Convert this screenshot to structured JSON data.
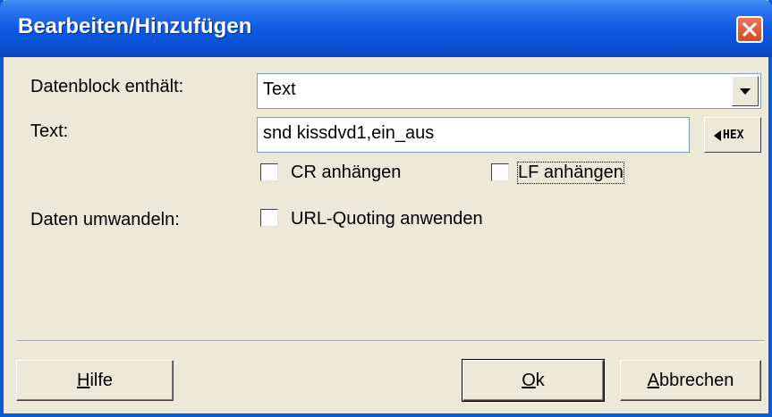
{
  "window": {
    "title": "Bearbeiten/Hinzufügen"
  },
  "labels": {
    "datenblock": "Datenblock enthält:",
    "text": "Text:",
    "daten": "Daten umwandeln:"
  },
  "datenblock_select": {
    "value": "Text"
  },
  "text_input": {
    "value": "snd kissdvd1,ein_aus"
  },
  "hex_button": {
    "label": "HEX"
  },
  "checkboxes": {
    "cr": {
      "label": "CR anhängen",
      "checked": false
    },
    "lf": {
      "label": "LF anhängen",
      "checked": false
    },
    "url": {
      "label": "URL-Quoting anwenden",
      "checked": false
    }
  },
  "buttons": {
    "hilfe": {
      "label_accel": "H",
      "label_rest": "ilfe"
    },
    "ok": {
      "label_accel": "O",
      "label_rest": "k"
    },
    "abbrechen": {
      "label_accel": "A",
      "label_rest": "bbrechen"
    }
  },
  "colors": {
    "titlebar": "#0a4fcf",
    "dialog_bg": "#ece9d8",
    "close": "#d24b25"
  },
  "icons": {
    "close": "close-icon",
    "dropdown": "dropdown-arrow-icon",
    "hex": "left-triangle-icon"
  }
}
